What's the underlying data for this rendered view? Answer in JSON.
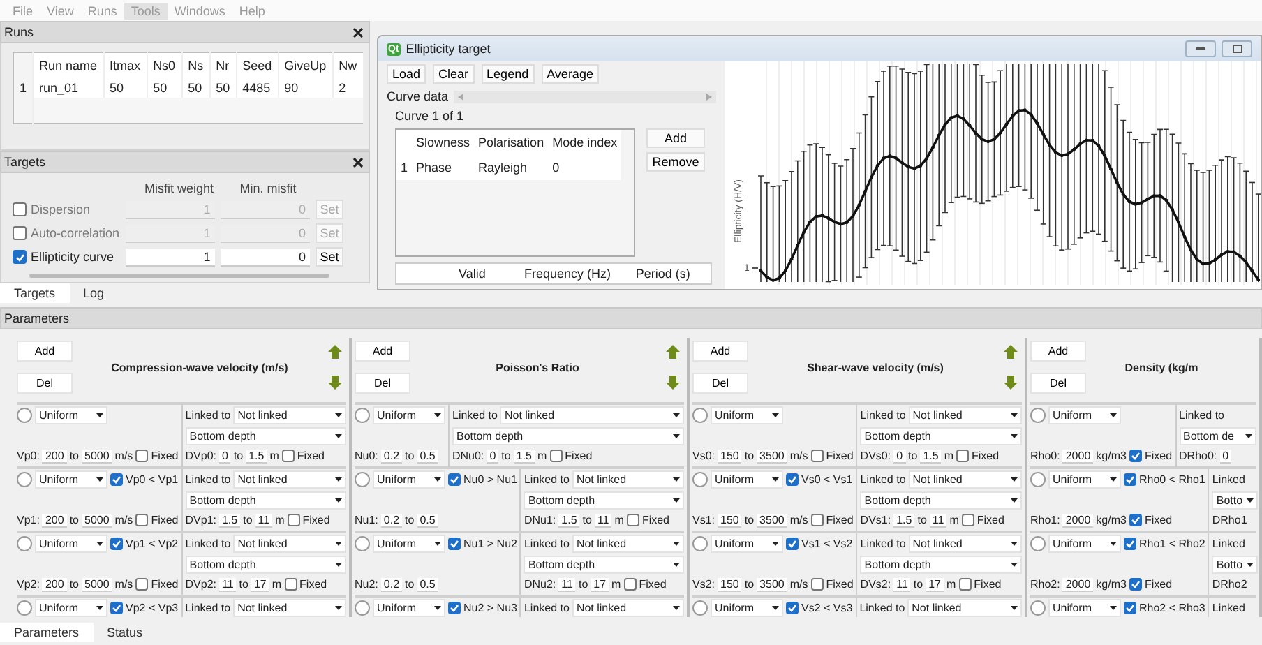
{
  "menu": [
    {
      "label": "File",
      "selected": false
    },
    {
      "label": "View",
      "selected": false
    },
    {
      "label": "Runs",
      "selected": false
    },
    {
      "label": "Tools",
      "selected": true
    },
    {
      "label": "Windows",
      "selected": false
    },
    {
      "label": "Help",
      "selected": false
    }
  ],
  "runs": {
    "title": "Runs",
    "columns": [
      "Run name",
      "Itmax",
      "Ns0",
      "Ns",
      "Nr",
      "Seed",
      "GiveUp",
      "Nw"
    ],
    "rows": [
      {
        "index": "1",
        "cells": [
          "run_01",
          "50",
          "50",
          "50",
          "50",
          "4485",
          "90",
          "2"
        ]
      }
    ]
  },
  "targets": {
    "title": "Targets",
    "columns": [
      "Misfit weight",
      "Min. misfit"
    ],
    "rows": [
      {
        "label": "Dispersion",
        "checked": false,
        "disabled": true,
        "weight": "1",
        "min_misfit": "0",
        "button": "Set"
      },
      {
        "label": "Auto-correlation",
        "checked": false,
        "disabled": true,
        "weight": "1",
        "min_misfit": "0",
        "button": "Set"
      },
      {
        "label": "Ellipticity curve",
        "checked": true,
        "disabled": false,
        "weight": "1",
        "min_misfit": "0",
        "button": "Set"
      }
    ]
  },
  "dock_tabs": [
    {
      "label": "Targets",
      "selected": true
    },
    {
      "label": "Log",
      "selected": false
    }
  ],
  "ellipticity": {
    "title": "Ellipticity target",
    "icon_text": "Qt",
    "toolbar": [
      "Load",
      "Clear",
      "Legend",
      "Average"
    ],
    "curve_data_label": "Curve data",
    "curve_counter": "Curve 1 of 1",
    "curves": {
      "columns": [
        "Slowness",
        "Polarisation",
        "Mode index"
      ],
      "rows": [
        {
          "index": "1",
          "cells": [
            "Phase",
            "Rayleigh",
            "0"
          ]
        }
      ]
    },
    "curve_buttons": [
      "Add",
      "Remove"
    ],
    "points": {
      "columns": [
        "Valid",
        "Frequency (Hz)",
        "Period (s)"
      ]
    },
    "plot": {
      "ylabel": "Ellipticity (H/V)",
      "ytick": "1"
    }
  },
  "parameters": {
    "title": "Parameters",
    "groups": [
      {
        "title": "Compression-wave velocity (m/s)",
        "add": "Add",
        "del": "Del",
        "has_arrows": true,
        "rows": [
          {
            "selected": false,
            "law": "Uniform",
            "range": {
              "label": "Vp0:",
              "min": "200",
              "sep": "to",
              "max": "5000",
              "unit": "m/s"
            },
            "fixed": {
              "label": "Fixed",
              "checked": false
            },
            "linked_label": "Linked to",
            "linked_value": "Not linked",
            "depth_mode": "Bottom depth",
            "depth": {
              "label": "DVp0:",
              "min": "0",
              "sep": "to",
              "max": "1.5",
              "unit": "m"
            },
            "depth_fixed": {
              "label": "Fixed",
              "checked": false
            }
          },
          {
            "selected": false,
            "law": "Uniform",
            "condition": {
              "label": "Vp0 < Vp1",
              "checked": true
            },
            "range": {
              "label": "Vp1:",
              "min": "200",
              "sep": "to",
              "max": "5000",
              "unit": "m/s"
            },
            "fixed": {
              "label": "Fixed",
              "checked": false
            },
            "linked_label": "Linked to",
            "linked_value": "Not linked",
            "depth_mode": "Bottom depth",
            "depth": {
              "label": "DVp1:",
              "min": "1.5",
              "sep": "to",
              "max": "11",
              "unit": "m"
            },
            "depth_fixed": {
              "label": "Fixed",
              "checked": false
            }
          },
          {
            "selected": false,
            "law": "Uniform",
            "condition": {
              "label": "Vp1 < Vp2",
              "checked": true
            },
            "range": {
              "label": "Vp2:",
              "min": "200",
              "sep": "to",
              "max": "5000",
              "unit": "m/s"
            },
            "fixed": {
              "label": "Fixed",
              "checked": false
            },
            "linked_label": "Linked to",
            "linked_value": "Not linked",
            "depth_mode": "Bottom depth",
            "depth": {
              "label": "DVp2:",
              "min": "11",
              "sep": "to",
              "max": "17",
              "unit": "m"
            },
            "depth_fixed": {
              "label": "Fixed",
              "checked": false
            }
          },
          {
            "selected": false,
            "law": "Uniform",
            "condition": {
              "label": "Vp2 < Vp3",
              "checked": true
            },
            "linked_label": "Linked to",
            "linked_value": "Not linked"
          }
        ]
      },
      {
        "title": "Poisson's Ratio",
        "add": "Add",
        "del": "Del",
        "has_arrows": true,
        "rows": [
          {
            "selected": false,
            "law": "Uniform",
            "range": {
              "label": "Nu0:",
              "min": "0.2",
              "sep": "to",
              "max": "0.5"
            },
            "linked_label": "Linked to",
            "linked_value": "Not linked",
            "depth_mode": "Bottom depth",
            "depth": {
              "label": "DNu0:",
              "min": "0",
              "sep": "to",
              "max": "1.5",
              "unit": "m"
            },
            "depth_fixed": {
              "label": "Fixed",
              "checked": false
            }
          },
          {
            "selected": false,
            "law": "Uniform",
            "condition": {
              "label": "Nu0 > Nu1",
              "checked": true
            },
            "range": {
              "label": "Nu1:",
              "min": "0.2",
              "sep": "to",
              "max": "0.5"
            },
            "linked_label": "Linked to",
            "linked_value": "Not linked",
            "depth_mode": "Bottom depth",
            "depth": {
              "label": "DNu1:",
              "min": "1.5",
              "sep": "to",
              "max": "11",
              "unit": "m"
            },
            "depth_fixed": {
              "label": "Fixed",
              "checked": false
            }
          },
          {
            "selected": false,
            "law": "Uniform",
            "condition": {
              "label": "Nu1 > Nu2",
              "checked": true
            },
            "range": {
              "label": "Nu2:",
              "min": "0.2",
              "sep": "to",
              "max": "0.5"
            },
            "linked_label": "Linked to",
            "linked_value": "Not linked",
            "depth_mode": "Bottom depth",
            "depth": {
              "label": "DNu2:",
              "min": "11",
              "sep": "to",
              "max": "17",
              "unit": "m"
            },
            "depth_fixed": {
              "label": "Fixed",
              "checked": false
            }
          },
          {
            "selected": false,
            "law": "Uniform",
            "condition": {
              "label": "Nu2 > Nu3",
              "checked": true
            },
            "linked_label": "Linked to",
            "linked_value": "Not linked"
          }
        ]
      },
      {
        "title": "Shear-wave velocity (m/s)",
        "add": "Add",
        "del": "Del",
        "has_arrows": true,
        "rows": [
          {
            "selected": false,
            "law": "Uniform",
            "range": {
              "label": "Vs0:",
              "min": "150",
              "sep": "to",
              "max": "3500",
              "unit": "m/s"
            },
            "fixed": {
              "label": "Fixed",
              "checked": false
            },
            "linked_label": "Linked to",
            "linked_value": "Not linked",
            "depth_mode": "Bottom depth",
            "depth": {
              "label": "DVs0:",
              "min": "0",
              "sep": "to",
              "max": "1.5",
              "unit": "m"
            },
            "depth_fixed": {
              "label": "Fixed",
              "checked": false
            }
          },
          {
            "selected": false,
            "law": "Uniform",
            "condition": {
              "label": "Vs0 < Vs1",
              "checked": true
            },
            "range": {
              "label": "Vs1:",
              "min": "150",
              "sep": "to",
              "max": "3500",
              "unit": "m/s"
            },
            "fixed": {
              "label": "Fixed",
              "checked": false
            },
            "linked_label": "Linked to",
            "linked_value": "Not linked",
            "depth_mode": "Bottom depth",
            "depth": {
              "label": "DVs1:",
              "min": "1.5",
              "sep": "to",
              "max": "11",
              "unit": "m"
            },
            "depth_fixed": {
              "label": "Fixed",
              "checked": false
            }
          },
          {
            "selected": false,
            "law": "Uniform",
            "condition": {
              "label": "Vs1 < Vs2",
              "checked": true
            },
            "range": {
              "label": "Vs2:",
              "min": "150",
              "sep": "to",
              "max": "3500",
              "unit": "m/s"
            },
            "fixed": {
              "label": "Fixed",
              "checked": false
            },
            "linked_label": "Linked to",
            "linked_value": "Not linked",
            "depth_mode": "Bottom depth",
            "depth": {
              "label": "DVs2:",
              "min": "11",
              "sep": "to",
              "max": "17",
              "unit": "m"
            },
            "depth_fixed": {
              "label": "Fixed",
              "checked": false
            }
          },
          {
            "selected": false,
            "law": "Uniform",
            "condition": {
              "label": "Vs2 < Vs3",
              "checked": true
            },
            "linked_label": "Linked to",
            "linked_value": "Not linked"
          }
        ]
      },
      {
        "title": "Density (kg/m",
        "add": "Add",
        "del": "Del",
        "has_arrows": false,
        "rows": [
          {
            "selected": false,
            "law": "Uniform",
            "range": {
              "label": "Rho0:",
              "min": "2000",
              "unit": "kg/m3"
            },
            "fixed": {
              "label": "Fixed",
              "checked": true
            },
            "linked_label": "Linked to",
            "depth_mode": "Bottom de",
            "depth": {
              "label": "DRho0:",
              "min": "0"
            }
          },
          {
            "selected": false,
            "law": "Uniform",
            "condition": {
              "label": "Rho0 < Rho1",
              "checked": true
            },
            "range": {
              "label": "Rho1:",
              "min": "2000",
              "unit": "kg/m3"
            },
            "fixed": {
              "label": "Fixed",
              "checked": true
            },
            "linked_label": "Linked",
            "depth_mode": "Botto",
            "depth": {
              "label": "DRho1"
            }
          },
          {
            "selected": false,
            "law": "Uniform",
            "condition": {
              "label": "Rho1 < Rho2",
              "checked": true
            },
            "range": {
              "label": "Rho2:",
              "min": "2000",
              "unit": "kg/m3"
            },
            "fixed": {
              "label": "Fixed",
              "checked": true
            },
            "linked_label": "Linked",
            "depth_mode": "Botto",
            "depth": {
              "label": "DRho2"
            }
          },
          {
            "selected": false,
            "law": "Uniform",
            "condition": {
              "label": "Rho2 < Rho3",
              "checked": true
            },
            "linked_label": "Linked"
          }
        ]
      }
    ]
  },
  "bottom_tabs": [
    {
      "label": "Parameters",
      "selected": true
    },
    {
      "label": "Status",
      "selected": false
    }
  ]
}
